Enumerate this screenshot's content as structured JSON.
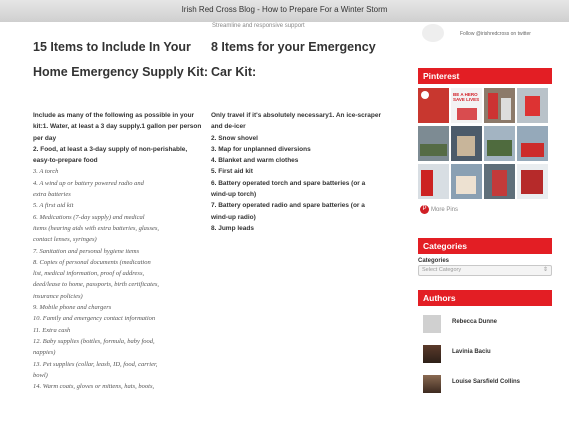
{
  "window": {
    "title": "Irish Red Cross Blog - How to Prepare For a Winter Storm"
  },
  "header_fragment": "Streamline and responsive support",
  "follow": {
    "text": "Follow @irishredcross on twitter"
  },
  "left_column": {
    "heading_line1": "15 Items to Include In Your",
    "heading_line2": "Home Emergency Supply Kit:",
    "lines": [
      {
        "text": "Include as many of the following as possible in your",
        "style": "b"
      },
      {
        "text": "kit:1. Water, at least a 3 day supply.1 gallon per person",
        "style": "b"
      },
      {
        "text": "per day",
        "style": "b"
      },
      {
        "text": "2. Food, at least a 3-day supply of non-perishable,",
        "style": "b"
      },
      {
        "text": "easy-to-prepare food",
        "style": "b"
      },
      {
        "text": "3. A torch",
        "style": "i"
      },
      {
        "text": "4. A wind up or battery powered radio and",
        "style": "i"
      },
      {
        "text": "extra batteries",
        "style": "i"
      },
      {
        "text": "5. A first aid kit",
        "style": "i"
      },
      {
        "text": "6. Medications (7-day supply) and medical",
        "style": "i"
      },
      {
        "text": "items (hearing aids with extra batteries, glasses,",
        "style": "i"
      },
      {
        "text": "contact lenses, syringes)",
        "style": "i"
      },
      {
        "text": "7. Sanitation and personal hygiene items",
        "style": "i"
      },
      {
        "text": "8. Copies of personal documents (medication",
        "style": "i"
      },
      {
        "text": "list, medical information, proof of address,",
        "style": "i"
      },
      {
        "text": "deed/lease to home, passports, birth certificates,",
        "style": "i"
      },
      {
        "text": "insurance policies)",
        "style": "i"
      },
      {
        "text": "9. Mobile phone and chargers",
        "style": "i"
      },
      {
        "text": "10. Family and emergency contact information",
        "style": "i"
      },
      {
        "text": "11. Extra cash",
        "style": "i"
      },
      {
        "text": "12. Baby supplies (bottles, formula, baby food,",
        "style": "i"
      },
      {
        "text": "nappies)",
        "style": "i"
      },
      {
        "text": "13. Pet supplies (collar, leash, ID, food, carrier,",
        "style": "i"
      },
      {
        "text": "bowl)",
        "style": "i"
      },
      {
        "text": "14. Warm coats, gloves or mittens, hats, boots,",
        "style": "i"
      }
    ]
  },
  "right_column": {
    "heading_line1": "8 Items for your Emergency",
    "heading_line2": "Car Kit:",
    "lines": [
      "Only travel if it's absolutely necessary1. An ice-scraper",
      "and de-icer",
      "2. Snow shovel",
      "3. Map for unplanned diversions",
      "4. Blanket and warm clothes",
      "5. First aid kit",
      "6. Battery operated torch and spare batteries (or a",
      "wind-up torch)",
      "7. Battery operated radio and spare batteries (or a",
      "wind-up radio)",
      "8. Jump leads"
    ]
  },
  "sidebar": {
    "pinterest": {
      "heading": "Pinterest",
      "more_pins": "More Pins",
      "banner_text": "BE A HERO SAVE LIVES",
      "tiles": [
        "pin-1",
        "pin-2",
        "pin-3",
        "pin-4",
        "pin-5",
        "pin-6",
        "pin-7",
        "pin-8",
        "pin-9",
        "pin-10",
        "pin-11",
        "pin-12"
      ]
    },
    "categories": {
      "heading": "Categories",
      "label": "Categories",
      "select_value": "Select Category"
    },
    "authors": {
      "heading": "Authors",
      "items": [
        {
          "name": "Rebecca Dunne"
        },
        {
          "name": "Lavinia Baciu"
        },
        {
          "name": "Louise Sarsfield Collins"
        }
      ]
    }
  },
  "colors": {
    "accent_red": "#e31e24",
    "heading_text": "#333333",
    "body_italic": "#555555"
  }
}
